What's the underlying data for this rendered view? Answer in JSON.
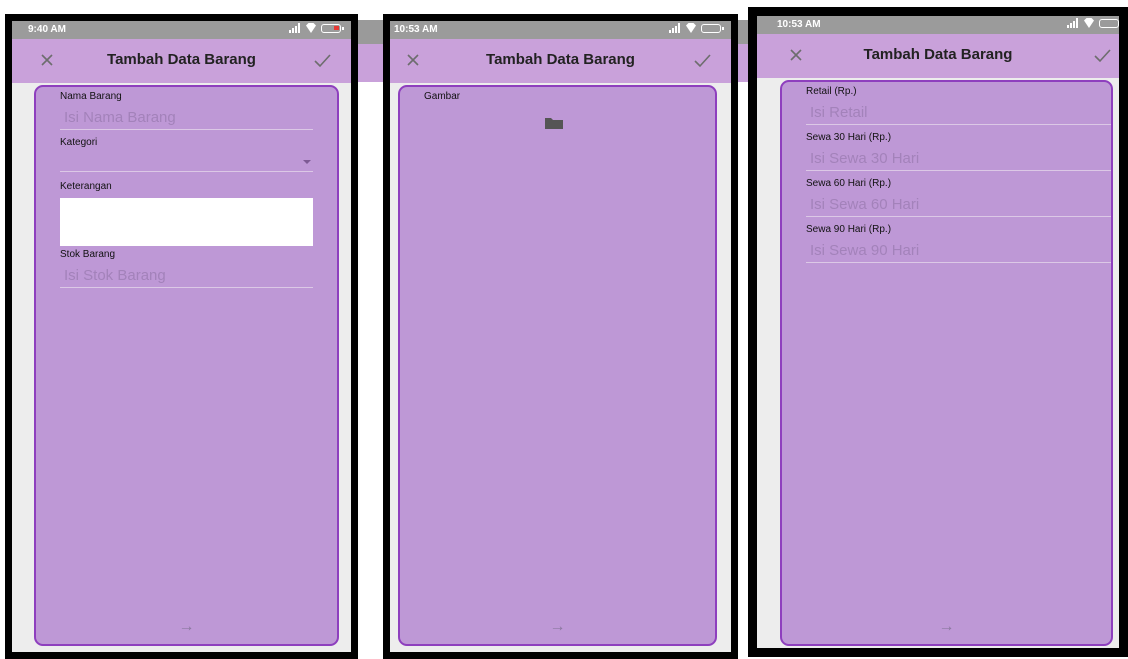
{
  "screens": [
    {
      "status_time": "9:40 AM",
      "title": "Tambah Data Barang",
      "fields": {
        "nama_label": "Nama Barang",
        "nama_placeholder": "Isi Nama Barang",
        "kategori_label": "Kategori",
        "keterangan_label": "Keterangan",
        "stok_label": "Stok Barang",
        "stok_placeholder": "Isi Stok Barang"
      }
    },
    {
      "status_time": "10:53 AM",
      "title": "Tambah Data Barang",
      "fields": {
        "gambar_label": "Gambar"
      }
    },
    {
      "status_time": "10:53 AM",
      "title": "Tambah Data Barang",
      "fields": {
        "retail_label": "Retail (Rp.)",
        "retail_placeholder": "Isi Retail",
        "sewa30_label": "Sewa 30 Hari (Rp.)",
        "sewa30_placeholder": "Isi Sewa 30 Hari",
        "sewa60_label": "Sewa 60 Hari (Rp.)",
        "sewa60_placeholder": "Isi Sewa 60 Hari",
        "sewa90_label": "Sewa 90 Hari (Rp.)",
        "sewa90_placeholder": "Isi Sewa 90 Hari"
      }
    }
  ],
  "icons": {
    "close": "close-icon",
    "confirm": "check-icon",
    "next": "arrow-right-icon",
    "folder": "folder-icon"
  },
  "colors": {
    "toolbar": "#c9a1da",
    "card": "#be98d6",
    "card_border": "#8e3fbe",
    "placeholder": "#a382ba"
  }
}
